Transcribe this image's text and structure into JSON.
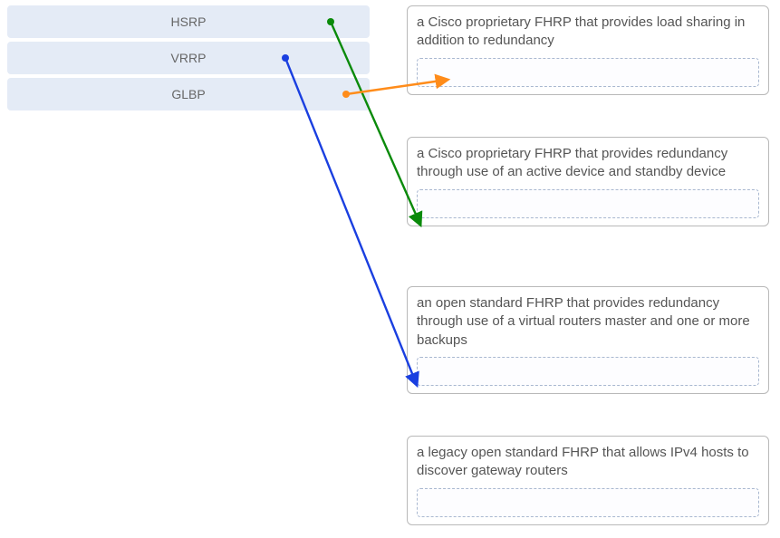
{
  "left_items": [
    {
      "label": "HSRP"
    },
    {
      "label": "VRRP"
    },
    {
      "label": "GLBP"
    }
  ],
  "right_items": [
    {
      "desc": "a Cisco proprietary FHRP that provides load sharing in addition to redundancy"
    },
    {
      "desc": "a Cisco proprietary FHRP that provides redundancy through use of an active device and standby device"
    },
    {
      "desc": "an open standard FHRP that provides redundancy through use of a virtual routers master and one or more backups"
    },
    {
      "desc": "a legacy open standard FHRP that allows IPv4 hosts to discover gateway routers"
    }
  ],
  "arrows": [
    {
      "from_left_index": 0,
      "to_right_index": 1,
      "color": "#0a8a0a"
    },
    {
      "from_left_index": 1,
      "to_right_index": 2,
      "color": "#1a3fe0"
    },
    {
      "from_left_index": 2,
      "to_right_index": 0,
      "color": "#ff8c1a"
    }
  ],
  "chart_data": {
    "type": "table",
    "title": "FHRP protocol matching",
    "series": [
      {
        "name": "HSRP",
        "values": [
          "a Cisco proprietary FHRP that provides redundancy through use of an active device and standby device"
        ]
      },
      {
        "name": "VRRP",
        "values": [
          "an open standard FHRP that provides redundancy through use of a virtual routers master and one or more backups"
        ]
      },
      {
        "name": "GLBP",
        "values": [
          "a Cisco proprietary FHRP that provides load sharing in addition to redundancy"
        ]
      }
    ]
  }
}
